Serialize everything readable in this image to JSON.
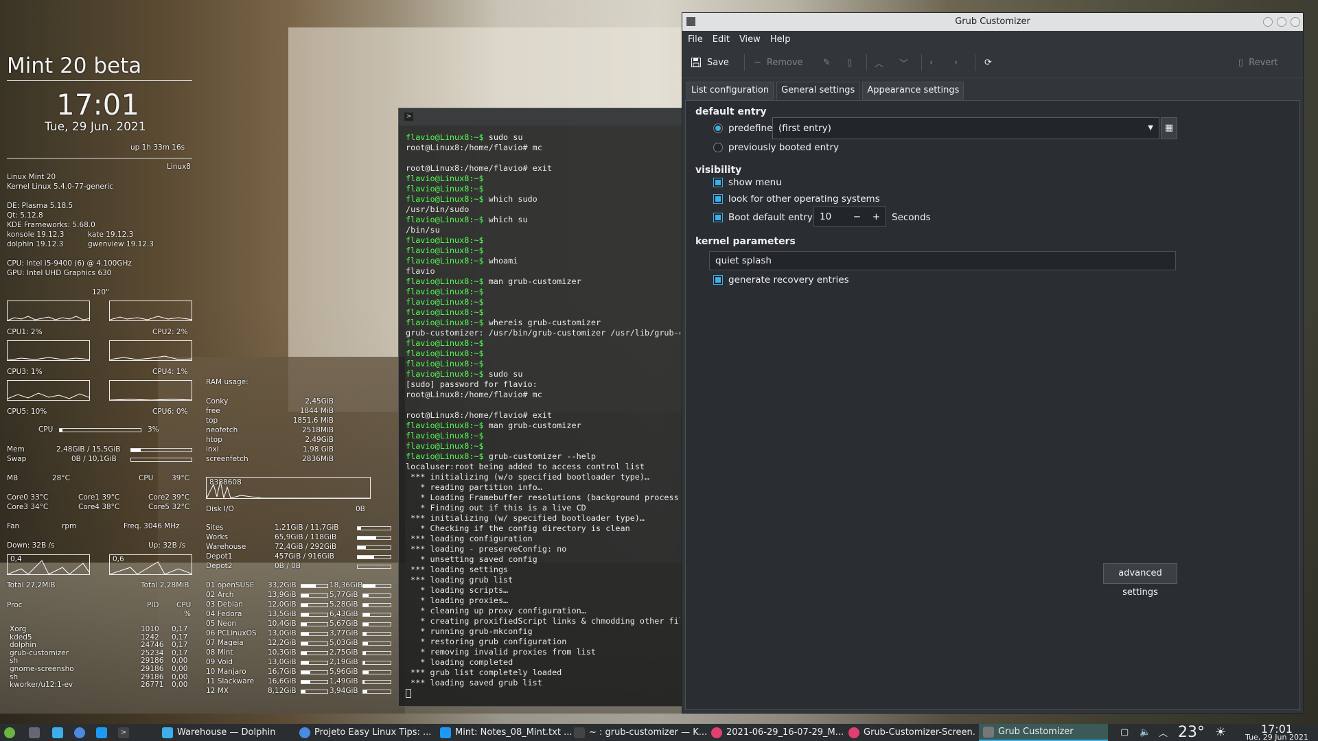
{
  "conky": {
    "title": "Mint 20 beta",
    "time": "17:01",
    "date": "Tue, 29 Jun. 2021",
    "uptime": "up  1h 33m 16s",
    "hostname": "Linux8",
    "distro": "Linux Mint 20",
    "kernel": "Kernel Linux 5.4.0-77-generic",
    "de": "DE: Plasma 5.18.5",
    "qt": "Qt: 5.12.8",
    "kf": "KDE Frameworks: 5.68.0",
    "konsole": "konsole 19.12.3",
    "kate": "kate 19.12.3",
    "dolphin_v": "dolphin 19.12.3",
    "gwenview": "gwenview 19.12.3",
    "cpu_info": "CPU: Intel i5-9400 (6) @ 4.100GHz",
    "gpu_info": "GPU: Intel UHD Graphics 630",
    "interval": "120\"",
    "cpu1": "CPU1: 2%",
    "cpu2": "CPU2: 2%",
    "cpu3": "CPU3: 1%",
    "cpu4": "CPU4: 1%",
    "cpu5": "CPU5: 10%",
    "cpu6": "CPU6: 0%",
    "cpu_label": "CPU",
    "cpu_total": "3%",
    "cpu_total_value": 3,
    "mem_label": "Mem",
    "mem_value": "2,48GiB / 15,5GiB",
    "mem_fraction": 0.16,
    "swap_label": "Swap",
    "swap_value": "0B  / 10,1GiB",
    "swap_fraction": 0,
    "mb_label": "MB",
    "mb_temp": "28°C",
    "cpu_temp_label": "CPU",
    "cpu_temp": "39°C",
    "core0": "Core0  33°C",
    "core1": "Core1  39°C",
    "core2": "Core2  39°C",
    "core3": "Core3  34°C",
    "core4": "Core4  38°C",
    "core5": "Core5  32°C",
    "fan": "Fan",
    "rpm": "rpm",
    "freq": "Freq.  3046   MHz",
    "down": "Down: 32B  /s",
    "up": "Up: 32B  /s",
    "down_scale": "0,4",
    "up_scale": "0,6",
    "total_down": "Total 27,2MiB",
    "total_up": "Total 2,28MiB",
    "proc_header": [
      "Proc",
      "PID",
      "CPU",
      "%"
    ],
    "procs": [
      [
        "Xorg",
        "1010",
        "0,17"
      ],
      [
        "kded5",
        "1242",
        "0,17"
      ],
      [
        "dolphin",
        "24746",
        "0,17"
      ],
      [
        "grub-customizer",
        "25234",
        "0,17"
      ],
      [
        "sh",
        "29186",
        "0,00"
      ],
      [
        "gnome-screensho",
        "29186",
        "0,00"
      ],
      [
        "sh",
        "29186",
        "0,00"
      ],
      [
        "kworker/u12:1-ev",
        "26771",
        "0,00"
      ]
    ],
    "ram_header": "RAM usage:",
    "ram": [
      [
        "Conky",
        "2,45GiB"
      ],
      [
        "free",
        "1844   MiB"
      ],
      [
        "top",
        "1851,6  MiB"
      ],
      [
        "neofetch",
        "2518MiB"
      ],
      [
        "htop",
        "2.49GiB"
      ],
      [
        "inxi",
        "1.98 GiB"
      ],
      [
        "screenfetch",
        "2836MiB"
      ]
    ],
    "disk_scale": "8388608",
    "disk_io": "Disk I/O",
    "disk_io_value": "0B",
    "disks": [
      [
        "Sites",
        "1,21GiB  /  11,7GiB",
        0.1
      ],
      [
        "Works",
        "65,9GiB  /  118GiB",
        0.56
      ],
      [
        "Warehouse",
        "72,4GiB  /  292GiB",
        0.25
      ],
      [
        "Depot1",
        "457GiB  /  916GiB",
        0.5
      ],
      [
        "Depot2",
        "0B   /   0B",
        0
      ]
    ],
    "parts": [
      [
        "01 openSUSE",
        "33,2GiB",
        0.55,
        "18,36GiB",
        0.45
      ],
      [
        "02 Arch",
        "13,9GiB",
        0.3,
        "5,77GiB",
        0.2
      ],
      [
        "03 Debian",
        "12,0GiB",
        0.25,
        "5,28GiB",
        0.2
      ],
      [
        "04 Fedora",
        "13,5GiB",
        0.3,
        "6,43GiB",
        0.25
      ],
      [
        "05 Neon",
        "10,4GiB",
        0.2,
        "5,67GiB",
        0.2
      ],
      [
        "06 PCLinuxOS",
        "13,0GiB",
        0.3,
        "3,77GiB",
        0.12
      ],
      [
        "07 Mageia",
        "12,2GiB",
        0.25,
        "5,03GiB",
        0.18
      ],
      [
        "08 Mint",
        "10,3GiB",
        0.2,
        "2,75GiB",
        0.1
      ],
      [
        "09 Void",
        "13,0GiB",
        0.3,
        "2,19GiB",
        0.08
      ],
      [
        "10 Manjaro",
        "16,7GiB",
        0.35,
        "5,96GiB",
        0.2
      ],
      [
        "11 Slackware",
        "16,6GiB",
        0.35,
        "1,49GiB",
        0.05
      ],
      [
        "12 MX",
        "8,12GiB",
        0.15,
        "3,94GiB",
        0.14
      ]
    ]
  },
  "terminal": {
    "lines": [
      [
        "p",
        "flavio@Linux8:~$",
        " sudo su"
      ],
      [
        "t",
        "root@Linux8:/home/flavio# mc",
        ""
      ],
      [
        "t",
        "",
        ""
      ],
      [
        "t",
        "root@Linux8:/home/flavio# exit",
        ""
      ],
      [
        "p",
        "flavio@Linux8:~$",
        ""
      ],
      [
        "p",
        "flavio@Linux8:~$",
        ""
      ],
      [
        "p",
        "flavio@Linux8:~$",
        " which sudo"
      ],
      [
        "t",
        "/usr/bin/sudo",
        ""
      ],
      [
        "p",
        "flavio@Linux8:~$",
        " which su"
      ],
      [
        "t",
        "/bin/su",
        ""
      ],
      [
        "p",
        "flavio@Linux8:~$",
        ""
      ],
      [
        "p",
        "flavio@Linux8:~$",
        ""
      ],
      [
        "p",
        "flavio@Linux8:~$",
        " whoami"
      ],
      [
        "t",
        "flavio",
        ""
      ],
      [
        "p",
        "flavio@Linux8:~$",
        " man grub-customizer"
      ],
      [
        "p",
        "flavio@Linux8:~$",
        ""
      ],
      [
        "p",
        "flavio@Linux8:~$",
        ""
      ],
      [
        "p",
        "flavio@Linux8:~$",
        ""
      ],
      [
        "p",
        "flavio@Linux8:~$",
        " whereis grub-customizer"
      ],
      [
        "t",
        "grub-customizer: /usr/bin/grub-customizer /usr/lib/grub-c",
        ""
      ],
      [
        "p",
        "flavio@Linux8:~$",
        ""
      ],
      [
        "p",
        "flavio@Linux8:~$",
        ""
      ],
      [
        "p",
        "flavio@Linux8:~$",
        ""
      ],
      [
        "p",
        "flavio@Linux8:~$",
        " sudo su"
      ],
      [
        "t",
        "[sudo] password for flavio:",
        ""
      ],
      [
        "t",
        "root@Linux8:/home/flavio# mc",
        ""
      ],
      [
        "t",
        "",
        ""
      ],
      [
        "t",
        "root@Linux8:/home/flavio# exit",
        ""
      ],
      [
        "p",
        "flavio@Linux8:~$",
        " man grub-customizer"
      ],
      [
        "p",
        "flavio@Linux8:~$",
        ""
      ],
      [
        "p",
        "flavio@Linux8:~$",
        ""
      ],
      [
        "p",
        "flavio@Linux8:~$",
        " grub-customizer --help"
      ],
      [
        "t",
        "localuser:root being added to access control list",
        ""
      ],
      [
        "t",
        " *** initializing (w/o specified bootloader type)…",
        ""
      ],
      [
        "t",
        "   * reading partition info…",
        ""
      ],
      [
        "t",
        "   * Loading Framebuffer resolutions (background process)",
        ""
      ],
      [
        "t",
        "   * Finding out if this is a live CD",
        ""
      ],
      [
        "t",
        " *** initializing (w/ specified bootloader type)…",
        ""
      ],
      [
        "t",
        "   * Checking if the config directory is clean",
        ""
      ],
      [
        "t",
        " *** loading configuration",
        ""
      ],
      [
        "t",
        " *** loading - preserveConfig: no",
        ""
      ],
      [
        "t",
        "   * unsetting saved config",
        ""
      ],
      [
        "t",
        " *** loading settings",
        ""
      ],
      [
        "t",
        " *** loading grub list",
        ""
      ],
      [
        "t",
        "   * loading scripts…",
        ""
      ],
      [
        "t",
        "   * loading proxies…",
        ""
      ],
      [
        "t",
        "   * cleaning up proxy configuration…",
        ""
      ],
      [
        "t",
        "   * creating proxifiedScript links & chmodding other file",
        ""
      ],
      [
        "t",
        "   * running grub-mkconfig",
        ""
      ],
      [
        "t",
        "   * restoring grub configuration",
        ""
      ],
      [
        "t",
        "   * removing invalid proxies from list",
        ""
      ],
      [
        "t",
        "   * loading completed",
        ""
      ],
      [
        "t",
        " *** grub list completely loaded",
        ""
      ],
      [
        "t",
        " *** loading saved grub list",
        ""
      ]
    ]
  },
  "grub": {
    "title": "Grub Customizer",
    "menu": [
      "File",
      "Edit",
      "View",
      "Help"
    ],
    "toolbar": {
      "save": "Save",
      "remove": "Remove",
      "revert": "Revert"
    },
    "tabs": [
      "List configuration",
      "General settings",
      "Appearance settings"
    ],
    "default_entry": {
      "heading": "default entry",
      "predefined": "predefined:",
      "value": "(first entry)",
      "previous": "previously booted entry"
    },
    "visibility": {
      "heading": "visibility",
      "show_menu": "show menu",
      "look_other": "look for other operating systems",
      "boot_after": "Boot default entry after",
      "timeout": "10",
      "seconds": "Seconds"
    },
    "kernel": {
      "heading": "kernel parameters",
      "params": "quiet splash",
      "recovery": "generate recovery entries"
    },
    "advanced": "advanced settings"
  },
  "taskbar": {
    "tasks": [
      "Warehouse — Dolphin",
      "Projeto Easy Linux Tips: ...",
      "Mint: Notes_08_Mint.txt ...",
      "~ : grub-customizer — K...",
      "2021-06-29_16-07-29_M...",
      "Grub-Customizer-Screen...",
      "Grub Customizer"
    ],
    "temp": "23°",
    "clock": "17:01",
    "date": "Tue, 29 Jun 2021"
  },
  "colors": {
    "accent": "#3daee9",
    "prompt": "#55ff55",
    "window_bg": "#31363b"
  }
}
